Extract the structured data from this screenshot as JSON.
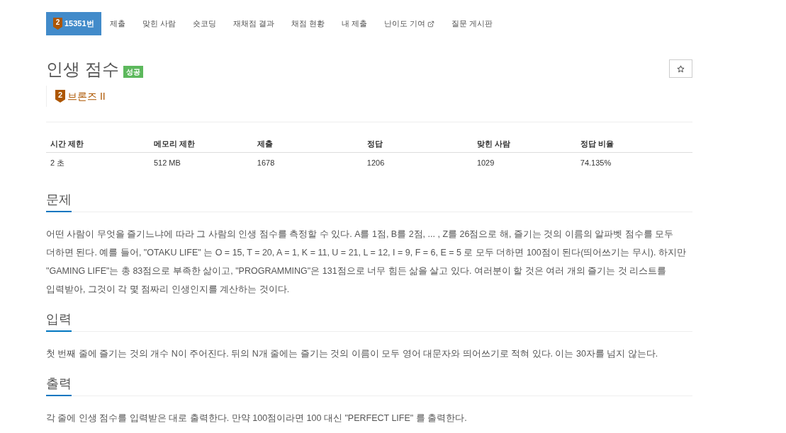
{
  "nav_tabs": [
    {
      "kind": "problem",
      "label": "15351번",
      "tier_number": "2",
      "selected": true
    },
    {
      "kind": "plain",
      "label": "제출",
      "selected": false
    },
    {
      "kind": "plain",
      "label": "맞힌 사람",
      "selected": false
    },
    {
      "kind": "plain",
      "label": "숏코딩",
      "selected": false
    },
    {
      "kind": "plain",
      "label": "재채점 결과",
      "selected": false
    },
    {
      "kind": "plain",
      "label": "채점 현황",
      "selected": false
    },
    {
      "kind": "plain",
      "label": "내 제출",
      "selected": false
    },
    {
      "kind": "external",
      "label": "난이도 기여",
      "selected": false
    },
    {
      "kind": "plain",
      "label": "질문 게시판",
      "selected": false
    }
  ],
  "problem": {
    "title": "인생 점수",
    "result_badge": "성공",
    "tier": {
      "number": "2",
      "label": "브론즈 II"
    }
  },
  "favorite_button": {
    "starred": false
  },
  "stats_table": {
    "columns": [
      "시간 제한",
      "메모리 제한",
      "제출",
      "정답",
      "맞힌 사람",
      "정답 비율"
    ],
    "rows": [
      [
        "2 초",
        "512 MB",
        "1678",
        "1206",
        "1029",
        "74.135%"
      ]
    ]
  },
  "sections": [
    {
      "title": "문제",
      "text": "어떤 사람이 무엇을 즐기느냐에 따라 그 사람의 인생 점수를 측정할 수 있다. A를 1점, B를 2점, ... , Z를 26점으로 해, 즐기는 것의 이름의 알파벳 점수를 모두 더하면 된다. 예를 들어, \"OTAKU LIFE\" 는 O = 15, T = 20, A = 1, K = 11, U = 21, L = 12, I = 9, F = 6, E = 5 로 모두 더하면 100점이 된다(띄어쓰기는 무시). 하지만 \"GAMING LIFE\"는 총 83점으로 부족한 삶이고, \"PROGRAMMING\"은 131점으로 너무 힘든 삶을 살고 있다. 여러분이 할 것은 여러 개의 즐기는 것 리스트를 입력받아, 그것이 각 몇 점짜리 인생인지를 계산하는 것이다."
    },
    {
      "title": "입력",
      "text": "첫 번째 줄에 즐기는 것의 개수 N이 주어진다. 뒤의 N개 줄에는 즐기는 것의 이름이 모두 영어 대문자와 띄어쓰기로 적혀 있다. 이는 30자를 넘지 않는다."
    },
    {
      "title": "출력",
      "text": "각 줄에 인생 점수를 입력받은 대로 출력한다. 만약 100점이라면 100 대신 \"PERFECT LIFE\" 를 출력한다."
    }
  ]
}
